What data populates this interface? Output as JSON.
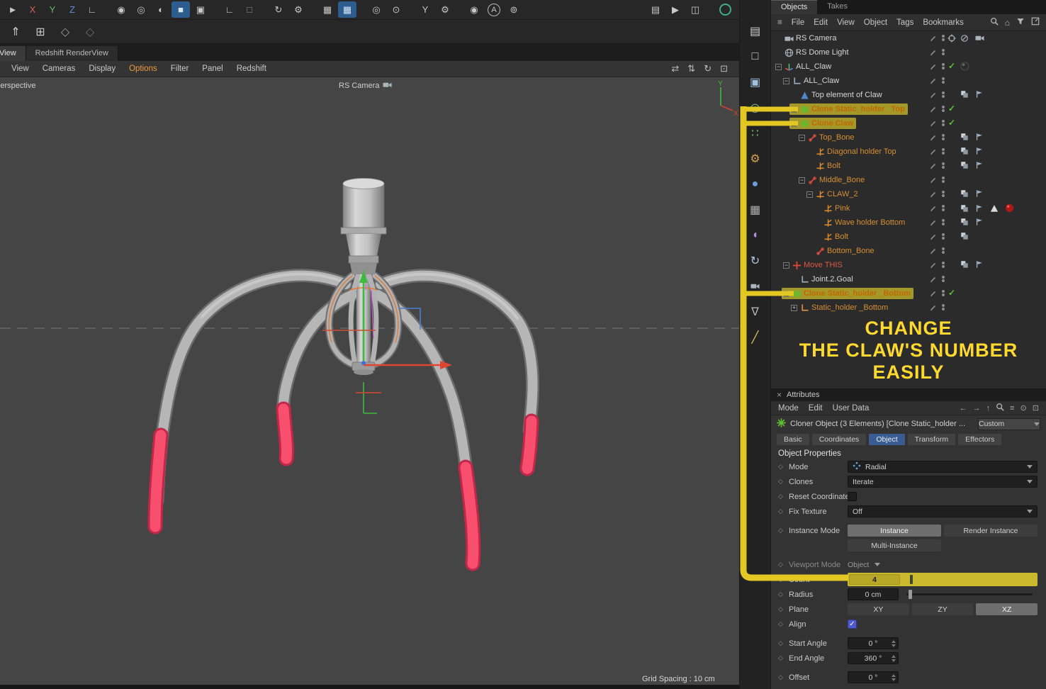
{
  "toolbar_main": {
    "items": [
      {
        "name": "pointer-tool-icon",
        "glyph": "►",
        "color": "#c8c8c8"
      },
      {
        "name": "lock-x-button",
        "glyph": "X",
        "color": "#d25f5f"
      },
      {
        "name": "lock-y-button",
        "glyph": "Y",
        "color": "#67b967"
      },
      {
        "name": "lock-z-button",
        "glyph": "Z",
        "color": "#5d8fd3"
      },
      {
        "name": "coord-system-icon",
        "glyph": "∟",
        "color": "#c8c8c8"
      },
      {
        "name": "sep"
      },
      {
        "name": "render-view-icon",
        "glyph": "◉",
        "color": "#c8c8c8"
      },
      {
        "name": "render-region-icon",
        "glyph": "◎",
        "color": "#c8c8c8"
      },
      {
        "name": "render-settings-icon",
        "glyph": "◐",
        "color": "#c8c8c8"
      },
      {
        "name": "primitive-cube-icon",
        "glyph": "■",
        "color": "#d7e6f5",
        "selected": true
      },
      {
        "name": "pen-spline-icon",
        "glyph": "▣",
        "color": "#c8c8c8"
      },
      {
        "name": "sep"
      },
      {
        "name": "corner-snap-icon",
        "glyph": "∟",
        "color": "#c8c8c8"
      },
      {
        "name": "quantize-icon",
        "glyph": "□",
        "color": "#8f8f8f"
      },
      {
        "name": "sep"
      },
      {
        "name": "refresh-icon",
        "glyph": "↻",
        "color": "#c8c8c8"
      },
      {
        "name": "gear-cycle-icon",
        "glyph": "⚙",
        "color": "#c8c8c8"
      },
      {
        "name": "sep"
      },
      {
        "name": "grid-icon",
        "glyph": "▦",
        "color": "#c8c8c8"
      },
      {
        "name": "grid-snap-icon",
        "glyph": "▦",
        "color": "#d7e6f5",
        "selected": true
      },
      {
        "name": "sep"
      },
      {
        "name": "target-circle-icon",
        "glyph": "◎",
        "color": "#c8c8c8"
      },
      {
        "name": "target-dot-icon",
        "glyph": "⊙",
        "color": "#c8c8c8"
      },
      {
        "name": "sep"
      },
      {
        "name": "split-y-icon",
        "glyph": "Y",
        "color": "#c8c8c8"
      },
      {
        "name": "small-gear-icon",
        "glyph": "⚙",
        "color": "#c8c8c8"
      },
      {
        "name": "sep"
      },
      {
        "name": "camera-round-icon",
        "glyph": "◉",
        "color": "#c8c8c8"
      },
      {
        "name": "annotation-a-icon",
        "glyph": "A",
        "color": "#c8c8c8",
        "style": "circle"
      },
      {
        "name": "lamp-icon",
        "glyph": "⊚",
        "color": "#c8c8c8"
      },
      {
        "name": "spacer"
      },
      {
        "name": "picture-viewer-icon",
        "glyph": "▤",
        "color": "#c8c8c8"
      },
      {
        "name": "play-render-icon",
        "glyph": "▶",
        "color": "#c8c8c8"
      },
      {
        "name": "frame-render-icon",
        "glyph": "◫",
        "color": "#c8c8c8"
      },
      {
        "name": "sep"
      },
      {
        "name": "interactive-render-icon",
        "style": "ring"
      }
    ]
  },
  "toolbar_second": {
    "items": [
      {
        "name": "make-editable-icon",
        "glyph": "⇑",
        "color": "#d8d8d8"
      },
      {
        "name": "add-object-icon",
        "glyph": "⊞",
        "color": "#c8c8c8"
      },
      {
        "name": "spline-path-icon",
        "glyph": "◇",
        "color": "#9a9a9a"
      },
      {
        "name": "spline-path2-icon",
        "glyph": "◇",
        "color": "#6f6f6f"
      }
    ]
  },
  "tool_strip": {
    "items": [
      {
        "name": "layout-manager-icon",
        "glyph": "▤",
        "color": "#d2d2d2"
      },
      {
        "name": "selection-box-icon",
        "glyph": "□",
        "color": "#d2d2d2"
      },
      {
        "name": "view-cube-icon",
        "glyph": "▣",
        "color": "#9fc0df"
      },
      {
        "name": "axis-mode-icon",
        "glyph": "◎",
        "color": "#7fc97f"
      },
      {
        "name": "mograph-icon",
        "glyph": "∷",
        "color": "#7fc97f"
      },
      {
        "name": "simulation-gear-icon",
        "glyph": "⚙",
        "color": "#d8a04a"
      },
      {
        "name": "volume-sphere-icon",
        "glyph": "●",
        "color": "#6f9fd8"
      },
      {
        "name": "workplane-grid-icon",
        "glyph": "▦",
        "color": "#b0b0b0"
      },
      {
        "name": "magnet-icon",
        "glyph": "◖",
        "color": "#b58fd8"
      },
      {
        "name": "rotate-ring-icon",
        "glyph": "↻",
        "color": "#b0c8e0"
      },
      {
        "name": "camera-strip-icon",
        "icon": "camera"
      },
      {
        "name": "funnel-icon",
        "glyph": "∇",
        "color": "#b0b0b0"
      },
      {
        "name": "pen-strip-icon",
        "glyph": "╱",
        "color": "#e0c060"
      }
    ]
  },
  "viewport": {
    "tabs": [
      {
        "label": "View",
        "active": true,
        "clipped": true
      },
      {
        "label": "Redshift RenderView",
        "active": false
      }
    ],
    "menu": [
      {
        "label": "View"
      },
      {
        "label": "Cameras"
      },
      {
        "label": "Display"
      },
      {
        "label": "Options",
        "highlight": true
      },
      {
        "label": "Filter"
      },
      {
        "label": "Panel"
      },
      {
        "label": "Redshift"
      }
    ],
    "nav_icons": [
      {
        "name": "pan-hand-icon",
        "glyph": "⇄"
      },
      {
        "name": "dolly-icon",
        "glyph": "⇅"
      },
      {
        "name": "orbit-icon",
        "glyph": "↻"
      },
      {
        "name": "maximize-view-icon",
        "glyph": "⊡"
      }
    ],
    "projection_label": "Perspective",
    "camera_label": "RS Camera",
    "grid_label": "Grid Spacing : 10 cm",
    "axis_labels": {
      "x": "X",
      "y": "Y"
    }
  },
  "object_manager": {
    "tabs": [
      {
        "label": "Objects",
        "active": true
      },
      {
        "label": "Takes",
        "active": false
      }
    ],
    "menu_icon": {
      "name": "panel-menu-icon",
      "glyph": "≡"
    },
    "menu": [
      "File",
      "Edit",
      "View",
      "Object",
      "Tags",
      "Bookmarks"
    ],
    "menu_icons": [
      {
        "name": "search-icon",
        "icon": "search"
      },
      {
        "name": "home-icon",
        "glyph": "⌂"
      },
      {
        "name": "filter-icon",
        "icon": "funnel"
      },
      {
        "name": "panel-icon",
        "icon": "panelbox"
      }
    ],
    "tree": [
      {
        "label": "RS Camera",
        "depth": 0,
        "icon": "camera",
        "color": "white",
        "right": "target",
        "badges": [
          "block",
          "camera"
        ]
      },
      {
        "label": "RS Dome Light",
        "depth": 0,
        "icon": "globe",
        "color": "white",
        "badges": []
      },
      {
        "label": "ALL_Claw",
        "depth": 0,
        "icon": "axis3",
        "color": "white",
        "expander": "minus",
        "right": "check",
        "badges": [
          "sphereDark"
        ]
      },
      {
        "label": "ALL_Claw",
        "depth": 1,
        "icon": "nullobj",
        "color": "white",
        "expander": "minus",
        "badges": []
      },
      {
        "label": "Top element of Claw",
        "depth": 2,
        "icon": "cone",
        "color": "white",
        "badges": [
          "layer",
          "flag"
        ]
      },
      {
        "label": "Clone Static_holder _Top",
        "depth": 2,
        "icon": "cloner",
        "color": "orange",
        "highlight": true,
        "expander": "plus",
        "right": "check",
        "badges": []
      },
      {
        "label": "Clone Claw",
        "depth": 2,
        "icon": "cloner",
        "color": "orange",
        "highlight": true,
        "expander": "minus",
        "right": "check",
        "badges": []
      },
      {
        "label": "Top_Bone",
        "depth": 3,
        "icon": "joint",
        "color": "orange",
        "expander": "minus",
        "badges": [
          "layer",
          "flag"
        ]
      },
      {
        "label": "Diagonal holder Top",
        "depth": 4,
        "icon": "poly",
        "color": "orange",
        "badges": [
          "layer",
          "flag"
        ]
      },
      {
        "label": "Bolt",
        "depth": 4,
        "icon": "poly",
        "color": "orange",
        "badges": [
          "layer",
          "flag"
        ]
      },
      {
        "label": "Middle_Bone",
        "depth": 3,
        "icon": "joint",
        "color": "orange",
        "expander": "minus",
        "badges": []
      },
      {
        "label": "CLAW_2",
        "depth": 4,
        "icon": "poly",
        "color": "orange",
        "expander": "minus",
        "badges": [
          "layer",
          "flag"
        ]
      },
      {
        "label": "Pink",
        "depth": 5,
        "icon": "poly",
        "color": "orange",
        "badges": [
          "layer",
          "flag",
          "warning",
          "sphereRed"
        ]
      },
      {
        "label": "Wave holder Bottom",
        "depth": 5,
        "icon": "poly",
        "color": "orange",
        "badges": [
          "layer",
          "flag"
        ]
      },
      {
        "label": "Bolt",
        "depth": 5,
        "icon": "poly",
        "color": "orange",
        "badges": [
          "layer"
        ]
      },
      {
        "label": "Bottom_Bone",
        "depth": 4,
        "icon": "joint",
        "color": "orange",
        "badges": []
      },
      {
        "label": "Move THIS",
        "depth": 1,
        "icon": "ik",
        "color": "red",
        "expander": "minus",
        "badges": [
          "layer",
          "flag"
        ]
      },
      {
        "label": "Joint.2.Goal",
        "depth": 2,
        "icon": "nullobj",
        "color": "white",
        "badges": []
      },
      {
        "label": "Clone Static_holder _Bottom",
        "depth": 1,
        "icon": "cloner",
        "color": "orange",
        "highlight": true,
        "expander": "minus",
        "right": "check",
        "badges": []
      },
      {
        "label": "Static_holder _Bottom",
        "depth": 2,
        "icon": "nullorange",
        "color": "orange",
        "expander": "plus",
        "badges": []
      }
    ]
  },
  "annotation": {
    "lines": [
      "CHANGE",
      "THE CLAW'S NUMBER",
      "EASILY"
    ],
    "color": "#ffd92e"
  },
  "attributes": {
    "panel_title": "Attributes",
    "menu": [
      "Mode",
      "Edit",
      "User Data"
    ],
    "menu_icons": [
      {
        "name": "back-icon",
        "glyph": "←"
      },
      {
        "name": "forward-icon",
        "glyph": "→"
      },
      {
        "name": "up-icon",
        "glyph": "↑"
      },
      {
        "name": "search-icon",
        "icon": "search"
      },
      {
        "name": "filter-menu-icon",
        "glyph": "≡"
      },
      {
        "name": "focus-icon",
        "glyph": "⊙"
      },
      {
        "name": "popout-icon",
        "glyph": "⊡"
      }
    ],
    "object_title": "Cloner Object (3 Elements) [Clone Static_holder ...",
    "preset_button": "Custom",
    "tabs": [
      {
        "label": "Basic"
      },
      {
        "label": "Coordinates"
      },
      {
        "label": "Object",
        "active": true
      },
      {
        "label": "Transform"
      },
      {
        "label": "Effectors"
      }
    ],
    "section_title": "Object Properties",
    "properties": [
      {
        "label": "Mode",
        "type": "select",
        "value": "Radial",
        "icon": "radial"
      },
      {
        "label": "Clones",
        "type": "select",
        "value": "Iterate"
      },
      {
        "label": "Reset Coordinates",
        "type": "checkbox",
        "checked": false
      },
      {
        "label": "Fix Texture",
        "type": "select",
        "value": "Off"
      },
      {
        "type": "gap"
      },
      {
        "label": "Instance Mode",
        "type": "buttons",
        "buttons": [
          {
            "label": "Instance",
            "selected": true
          },
          {
            "label": "Render Instance"
          }
        ]
      },
      {
        "label": "",
        "type": "buttons",
        "buttons": [
          {
            "label": "Multi-Instance"
          }
        ]
      },
      {
        "type": "gap"
      },
      {
        "label": "Viewport Mode",
        "type": "select_plain",
        "value": "Object",
        "disabled": true
      },
      {
        "label": "Count",
        "type": "count",
        "value": "4"
      },
      {
        "label": "Radius",
        "type": "number_slider",
        "value": "0 cm",
        "slider": 0.03
      },
      {
        "label": "Plane",
        "type": "buttons",
        "buttons": [
          {
            "label": "XY"
          },
          {
            "label": "ZY"
          },
          {
            "label": "XZ",
            "selected": true
          }
        ]
      },
      {
        "label": "Align",
        "type": "checkbox",
        "checked": true
      },
      {
        "type": "gap"
      },
      {
        "label": "Start Angle",
        "type": "number",
        "value": "0 °"
      },
      {
        "label": "End Angle",
        "type": "number",
        "value": "360 °"
      },
      {
        "type": "gap"
      },
      {
        "label": "Offset",
        "type": "number",
        "value": "0 °"
      }
    ]
  }
}
